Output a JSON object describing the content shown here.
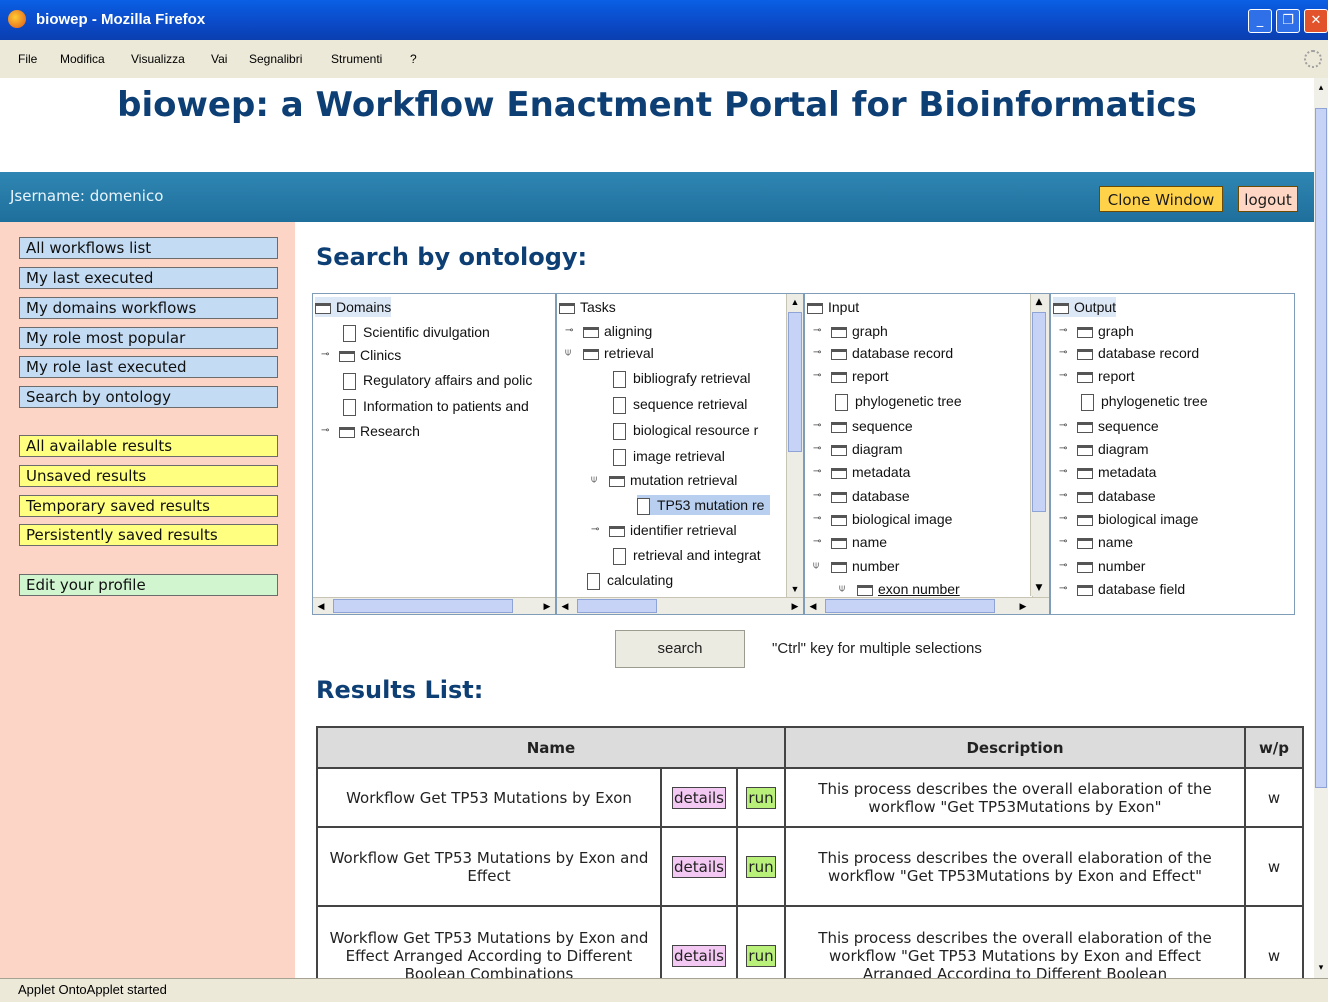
{
  "window": {
    "title": "biowep - Mozilla Firefox"
  },
  "menu": [
    "File",
    "Modifica",
    "Visualizza",
    "Vai",
    "Segnalibri",
    "Strumenti",
    "?"
  ],
  "banner": {
    "title": "biowep: a Workflow Enactment Portal for Bioinformatics"
  },
  "userbar": {
    "username_text": "Jsername: domenico",
    "clone_label": "Clone Window",
    "logout_label": "logout"
  },
  "sidebar": {
    "nav": [
      "All workflows list",
      "My last executed",
      "My domains workflows",
      "My role most popular",
      "My role last executed",
      "Search by ontology"
    ],
    "results": [
      "All available results",
      "Unsaved results",
      "Temporary saved results",
      "Persistently saved results"
    ],
    "profile": "Edit your profile"
  },
  "search": {
    "heading": "Search by ontology:",
    "domains": [
      "Domains",
      "Scientific divulgation",
      "Clinics",
      "Regulatory affairs and polic",
      "Information to patients and",
      "Research"
    ],
    "tasks": [
      "Tasks",
      "aligning",
      "retrieval",
      "bibliografy retrieval",
      "sequence retrieval",
      "biological resource r",
      "image retrieval",
      "mutation retrieval",
      "TP53 mutation re",
      "identifier retrieval",
      "retrieval and integrat",
      "calculating"
    ],
    "input": [
      "Input",
      "graph",
      "database record",
      "report",
      "phylogenetic tree",
      "sequence",
      "diagram",
      "metadata",
      "database",
      "biological image",
      "name",
      "number",
      "exon number"
    ],
    "output": [
      "Output",
      "graph",
      "database record",
      "report",
      "phylogenetic tree",
      "sequence",
      "diagram",
      "metadata",
      "database",
      "biological image",
      "name",
      "number",
      "database field"
    ],
    "button": "search",
    "hint": "\"Ctrl\" key for multiple selections"
  },
  "results": {
    "heading": "Results List:",
    "columns": [
      "Name",
      "Description",
      "w/p"
    ],
    "details_label": "details",
    "run_label": "run",
    "rows": [
      {
        "name": "Workflow Get TP53 Mutations by Exon",
        "description": "This process describes the overall elaboration of the workflow \"Get TP53Mutations by Exon\"",
        "wp": "w"
      },
      {
        "name": "Workflow Get TP53 Mutations by Exon and Effect",
        "description": "This process describes the overall elaboration of the workflow \"Get TP53Mutations by Exon and Effect\"",
        "wp": "w"
      },
      {
        "name": "Workflow Get TP53 Mutations by Exon and Effect Arranged According to Different Boolean Combinations",
        "description": "This process describes the overall elaboration of the workflow \"Get TP53 Mutations by Exon and Effect Arranged According to Different Boolean",
        "wp": "w"
      }
    ]
  },
  "statusbar": {
    "text": "Applet OntoApplet started"
  }
}
